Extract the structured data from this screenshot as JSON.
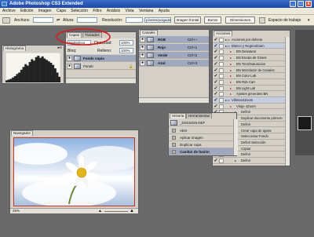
{
  "titlebar": {
    "title": "Adobe Photoshop CS3 Extended",
    "minimize": "_",
    "maximize": "□",
    "close": "x"
  },
  "menu": [
    "Archivo",
    "Edición",
    "Imagen",
    "Capa",
    "Selección",
    "Filtro",
    "Análisis",
    "Vista",
    "Ventana",
    "Ayuda"
  ],
  "options": {
    "width_label": "Anchura:",
    "height_label": "Altura:",
    "resolution_label": "Resolución:",
    "resolution_unit": "píxeles/pulgada",
    "front_image_button": "Imagen frontal",
    "clear_button": "Borrar",
    "dimensions_button": "Dimensiones",
    "workspace_label": "Espacio de trabajo"
  },
  "histogram": {
    "tab": "Histograma",
    "bars": [
      3,
      4,
      5,
      7,
      9,
      12,
      14,
      18,
      22,
      26,
      24,
      29,
      33,
      31,
      36,
      38,
      35,
      37,
      34,
      32,
      30,
      28,
      25,
      20,
      14,
      8
    ]
  },
  "layers": {
    "tabs": [
      "Capas",
      "Trazados"
    ],
    "blend_mode": "Multiplicar",
    "opacity_label": "Opacidad:",
    "opacity_value": "100%",
    "lock_label": "Bloq:",
    "fill_label": "Relleno:",
    "fill_value": "100%",
    "items": [
      {
        "name": "Fondo copia",
        "selected": true
      },
      {
        "name": "Fondo",
        "selected": false
      }
    ]
  },
  "channels": {
    "tab": "Canales",
    "items": [
      {
        "name": "RGB",
        "shortcut": "Ctrl+~"
      },
      {
        "name": "Rojo",
        "shortcut": "Ctrl+1"
      },
      {
        "name": "Verde",
        "shortcut": "Ctrl+2"
      },
      {
        "name": "Azul",
        "shortcut": "Ctrl+3"
      }
    ]
  },
  "actions": {
    "tab": "Acciones",
    "items": [
      {
        "label": "Acciones por defecto",
        "indent": 0,
        "highlight": false
      },
      {
        "label": "Blanco y Negro4Zoom",
        "indent": 0,
        "highlight": true
      },
      {
        "label": "BN Desaturar",
        "indent": 1,
        "highlight": false
      },
      {
        "label": "BN Escala de Grises",
        "indent": 1,
        "highlight": false
      },
      {
        "label": "BN Tono/Saturacion",
        "indent": 1,
        "highlight": false
      },
      {
        "label": "BN Mezclador de Canales",
        "indent": 1,
        "highlight": false
      },
      {
        "label": "BN Color Lab",
        "indent": 1,
        "highlight": false
      },
      {
        "label": "BN Rob Carr",
        "indent": 1,
        "highlight": false
      },
      {
        "label": "BN Light Lab",
        "indent": 1,
        "highlight": false
      },
      {
        "label": "Ajustes generales BN",
        "indent": 1,
        "highlight": false
      },
      {
        "label": "Viñeteo4Zoom",
        "indent": 0,
        "highlight": true
      },
      {
        "label": "Viraje 4Zoom",
        "indent": 1,
        "highlight": false
      },
      {
        "label": "Definir",
        "indent": 2,
        "highlight": false
      },
      {
        "label": "Duplicar documento primero",
        "indent": 2,
        "highlight": false
      },
      {
        "label": "Definir",
        "indent": 2,
        "highlight": false
      },
      {
        "label": "Crear capa de ajuste",
        "indent": 2,
        "highlight": false
      },
      {
        "label": "Seleccionar Fondo",
        "indent": 2,
        "highlight": false
      },
      {
        "label": "Definir Selección",
        "indent": 2,
        "highlight": false
      },
      {
        "label": "Copiar",
        "indent": 2,
        "highlight": false
      },
      {
        "label": "Definir",
        "indent": 2,
        "highlight": false
      },
      {
        "label": "Definir",
        "indent": 2,
        "highlight": false
      }
    ]
  },
  "history": {
    "tabs": [
      "Historia",
      "Herramientas"
    ],
    "snapshot": "_DSC5026.NEF",
    "items": [
      {
        "name": "Abrir",
        "selected": false
      },
      {
        "name": "Aplicar imagen",
        "selected": false
      },
      {
        "name": "Duplicar capa",
        "selected": false
      },
      {
        "name": "Cambio de fusión",
        "selected": true
      }
    ]
  },
  "navigator": {
    "tab": "Navegador",
    "zoom": "25%"
  }
}
